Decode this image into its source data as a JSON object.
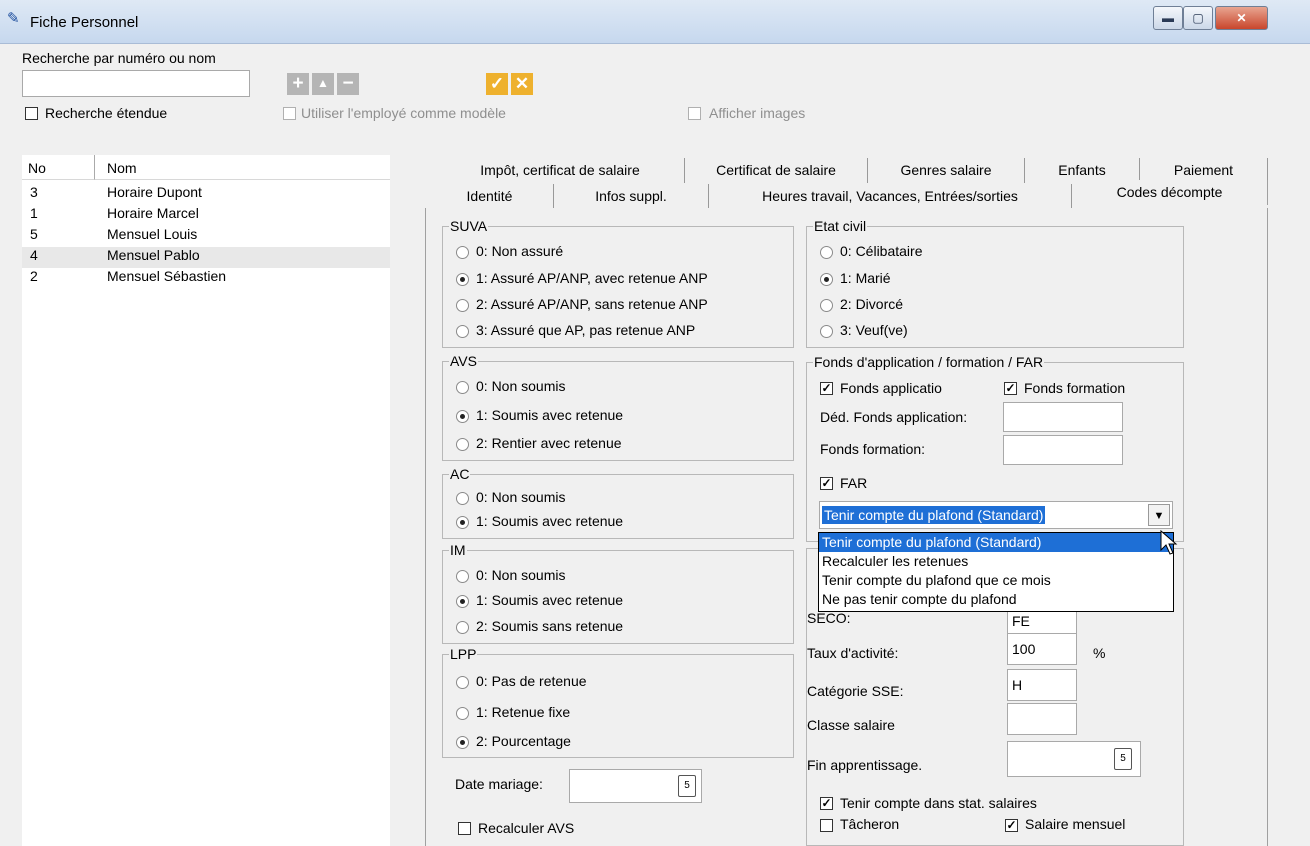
{
  "window": {
    "title": "Fiche Personnel",
    "min": "▬",
    "max": "▢",
    "close": "✕"
  },
  "search": {
    "label": "Recherche par numéro ou nom",
    "value": ""
  },
  "toolbar": {
    "add": "+",
    "up": "▲",
    "remove": "−",
    "ok": "✓",
    "cancel": "✕"
  },
  "options": {
    "extended": "Recherche étendue",
    "template": "Utiliser l'employé comme modèle",
    "images": "Afficher images"
  },
  "list": {
    "headers": [
      "No",
      "Nom"
    ],
    "rows": [
      {
        "no": "3",
        "name": "Horaire Dupont"
      },
      {
        "no": "1",
        "name": "Horaire Marcel"
      },
      {
        "no": "5",
        "name": "Mensuel Louis"
      },
      {
        "no": "4",
        "name": "Mensuel Pablo"
      },
      {
        "no": "2",
        "name": "Mensuel Sébastien"
      }
    ]
  },
  "tabs": {
    "row1": [
      "Impôt, certificat de salaire",
      "Certificat de salaire",
      "Genres salaire",
      "Enfants",
      "Paiement"
    ],
    "row2": [
      "Identité",
      "Infos suppl.",
      "Heures travail, Vacances, Entrées/sorties",
      "Codes décompte"
    ]
  },
  "suva": {
    "title": "SUVA",
    "options": [
      "0: Non assuré",
      "1: Assuré AP/ANP, avec retenue ANP",
      "2: Assuré AP/ANP, sans retenue ANP",
      "3: Assuré que AP, pas retenue ANP"
    ]
  },
  "avs": {
    "title": "AVS",
    "options": [
      "0: Non soumis",
      "1: Soumis avec retenue",
      "2: Rentier avec retenue"
    ]
  },
  "ac": {
    "title": "AC",
    "options": [
      "0: Non soumis",
      "1: Soumis avec retenue"
    ]
  },
  "im": {
    "title": "IM",
    "options": [
      "0: Non soumis",
      "1: Soumis avec retenue",
      "2: Soumis sans retenue"
    ]
  },
  "lpp": {
    "title": "LPP",
    "options": [
      "0: Pas de retenue",
      "1: Retenue fixe",
      "2: Pourcentage"
    ]
  },
  "date_mariage": {
    "label": "Date mariage:",
    "value": ""
  },
  "recalc": "Recalculer AVS",
  "etat": {
    "title": "Etat civil",
    "options": [
      "0: Célibataire",
      "1: Marié",
      "2: Divorcé",
      "3: Veuf(ve)"
    ]
  },
  "fonds": {
    "title": "Fonds d'application / formation / FAR",
    "app": "Fonds applicatio",
    "form": "Fonds formation",
    "ded_label": "Déd. Fonds application:",
    "form_label": "Fonds formation:",
    "far": "FAR",
    "selected": "Tenir compte du plafond (Standard)"
  },
  "dropdown": [
    "Tenir compte du plafond (Standard)",
    "Recalculer les retenues",
    "Tenir compte du plafond que ce mois",
    "Ne pas tenir compte du plafond"
  ],
  "lower": {
    "seco_label": "SECO:",
    "seco_value": "FE",
    "taux_label": "Taux d'activité:",
    "taux_value": "100",
    "pct": "%",
    "cat_label": "Catégorie SSE:",
    "cat_value": "H",
    "classe_label": "Classe salaire",
    "classe_value": "",
    "fin_label": "Fin apprentissage.",
    "fin_value": "",
    "stat": "Tenir compte dans stat. salaires",
    "tacheron": "Tâcheron",
    "mensuel": "Salaire mensuel"
  },
  "icons": {
    "calendar": "5",
    "check": "✓",
    "arrow": "▼"
  }
}
